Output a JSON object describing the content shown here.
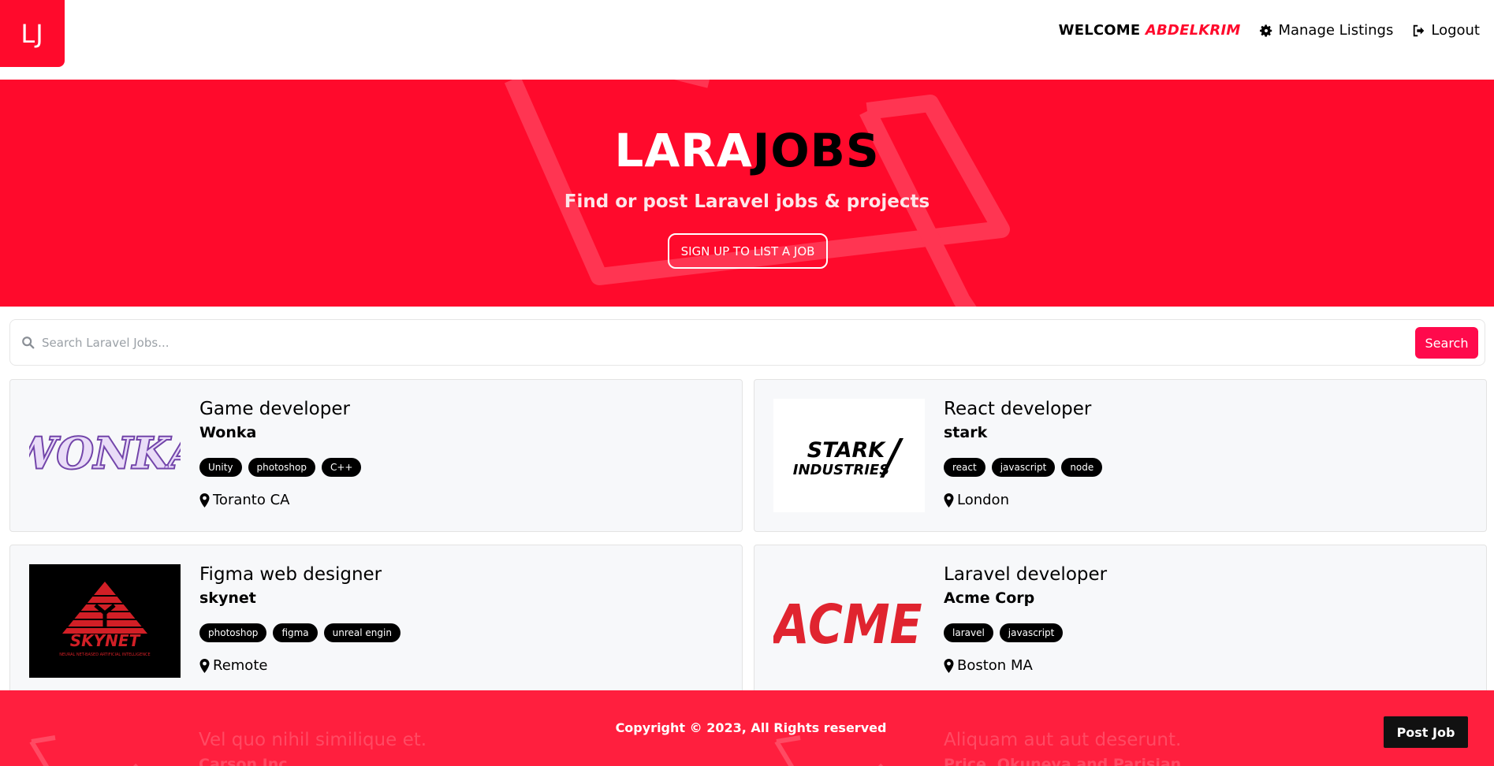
{
  "nav": {
    "logo": "LJ",
    "welcome_prefix": "WELCOME ",
    "welcome_user": "ABDELKRIM",
    "manage_label": "Manage Listings",
    "logout_label": "Logout"
  },
  "hero": {
    "title_a": "LARA",
    "title_b": "JOBS",
    "subtitle": "Find or post Laravel jobs & projects",
    "cta": "SIGN UP TO LIST A JOB"
  },
  "search": {
    "placeholder": "Search Laravel Jobs...",
    "button": "Search"
  },
  "listings": [
    {
      "title": "Game developer",
      "company": "Wonka",
      "tags": [
        "Unity",
        "photoshop",
        "C++"
      ],
      "location": "Toranto CA",
      "logo": "wonka-logo"
    },
    {
      "title": "React developer",
      "company": "stark",
      "tags": [
        "react",
        "javascript",
        "node"
      ],
      "location": "London",
      "logo": "stark-industries-logo"
    },
    {
      "title": "Figma web designer",
      "company": "skynet",
      "tags": [
        "photoshop",
        "figma",
        "unreal engin"
      ],
      "location": "Remote",
      "logo": "skynet-logo"
    },
    {
      "title": "Laravel developer",
      "company": "Acme Corp",
      "tags": [
        "laravel",
        "javascript"
      ],
      "location": "Boston MA",
      "logo": "acme-logo"
    }
  ],
  "ghost_listings": [
    {
      "title": "Vel quo nihil similique et.",
      "company": "Carson Inc"
    },
    {
      "title": "Aliquam aut aut deserunt.",
      "company": "Price, Okuneva and Parisian"
    }
  ],
  "footer": {
    "copyright": "Copyright © 2023, All Rights reserved",
    "post_job": "Post Job"
  },
  "colors": {
    "brand": "#ff0a2c",
    "footer": "#ff1f3e",
    "tag_bg": "#000000"
  },
  "logo_text": {
    "wonka": "WONKA",
    "stark": [
      "STARK",
      "INDUSTRIES"
    ],
    "skynet": "SKYNET",
    "skynet_sub": "NEURAL NET-BASED ARTIFICIAL INTELLIGENCE",
    "acme": "ACME"
  }
}
